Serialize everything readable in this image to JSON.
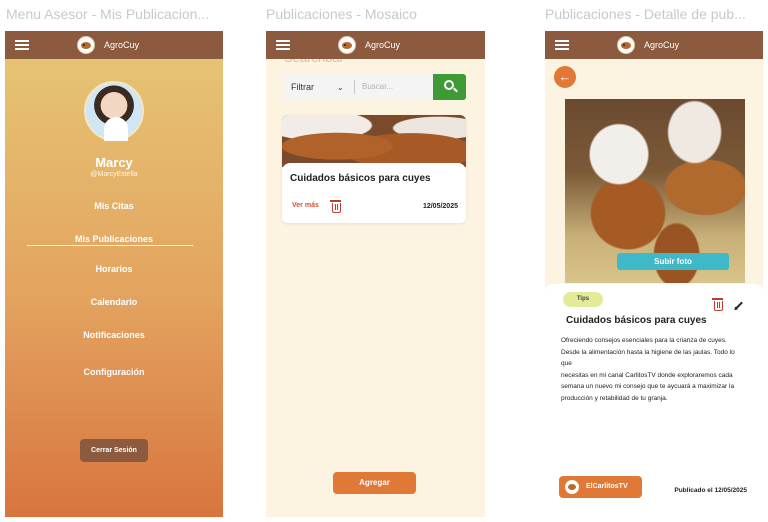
{
  "frames": {
    "menu_title": "Menu Asesor - Mis Publicacion...",
    "mosaic_title": "Publicaciones - Mosaico",
    "detail_title": "Publicaciones - Detalle de pub..."
  },
  "app": {
    "brand": "AgroCuy"
  },
  "menu": {
    "user_name": "Marcy",
    "user_handle": "@MarcyEstella",
    "items": [
      "Mis Citas",
      "Mis Publicaciones",
      "Horarios",
      "Calendario",
      "Notificaciones",
      "Configuración"
    ],
    "active_item": "Mis Publicaciones",
    "logout": "Cerrar Sesión"
  },
  "mosaic": {
    "ghost_label": "Searchbar",
    "filter_label": "Filtrar",
    "search_placeholder": "Buscar...",
    "card": {
      "title": "Cuidados básicos para cuyes",
      "more": "Ver más",
      "date": "12/05/2025"
    },
    "add_button": "Agregar"
  },
  "detail": {
    "upload_button": "Subir foto",
    "tag": "Tips",
    "title": "Cuidados básicos para cuyes",
    "description_lines": [
      "Ofreciendo consejos esenciales para la crianza de cuyes.",
      "Desde la alimentación hasta la higiene de las jaulas. Todo lo",
      "que",
      "necesitas en mi canal CarlitosTV donde exploraremos cada",
      "semana un nuevo mi consejo que te aycuará a maximizar la",
      "producción y retabilidad de tu granja."
    ],
    "author": "ElCarlitosTV",
    "published": "Publicado el 12/05/2025"
  },
  "colors": {
    "topbar": "#8c5a3e",
    "accent_orange": "#e07838",
    "search_green": "#3e9a34",
    "upload_cyan": "#3fb8c8",
    "danger_red": "#c43a2a",
    "tag_bg": "#e3ea9a",
    "cream_bg": "#fdf3e1"
  },
  "icons": [
    "hamburger-icon",
    "logo-icon",
    "chevron-down-icon",
    "search-icon",
    "trash-icon",
    "arrow-left-icon",
    "pencil-icon",
    "avatar-icon"
  ]
}
